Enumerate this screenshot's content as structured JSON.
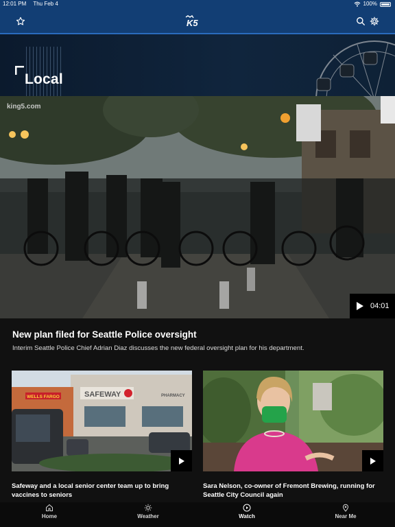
{
  "status_bar": {
    "time": "12:01 PM",
    "date": "Thu Feb 4",
    "battery": "100%"
  },
  "header": {
    "logo_text": "K5"
  },
  "section": {
    "title": "Local"
  },
  "hero": {
    "watermark": "king5.com",
    "duration": "04:01",
    "title": "New plan filed for Seattle Police oversight",
    "description": "Interim Seattle Police Chief Adrian Diaz discusses the new federal oversight plan for his department."
  },
  "cards": [
    {
      "title": "Safeway and a local senior center team up to bring vaccines to seniors",
      "sign_text": "SAFEWAY",
      "sign_text_2": "WELLS FARGO",
      "sign_text_3": "PHARMACY"
    },
    {
      "title": "Sara Nelson, co-owner of Fremont Brewing, running for Seattle City Council again"
    }
  ],
  "tabs": [
    {
      "label": "Home",
      "icon": "home-icon"
    },
    {
      "label": "Weather",
      "icon": "sun-icon"
    },
    {
      "label": "Watch",
      "icon": "play-circle-icon",
      "active": true
    },
    {
      "label": "Near Me",
      "icon": "location-pin-icon"
    }
  ],
  "colors": {
    "header_bg": "#123e74",
    "header_border": "#2a6bbd",
    "page_bg": "#111111",
    "active_tab": "#ffffff"
  }
}
